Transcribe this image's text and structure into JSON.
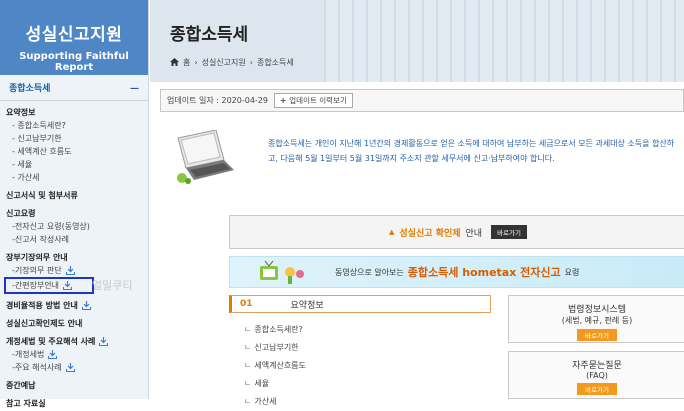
{
  "sidebar": {
    "brand_title": "성실신고지원",
    "brand_sub": "Supporting Faithful Report",
    "category": "종합소득세",
    "collapse": "—",
    "items": [
      {
        "label": "요약정보",
        "level": "h",
        "download": false
      },
      {
        "label": "- 종합소득세란?",
        "level": "s",
        "download": false
      },
      {
        "label": "- 신고납부기한",
        "level": "s",
        "download": false
      },
      {
        "label": "- 세액계산 흐름도",
        "level": "s",
        "download": false
      },
      {
        "label": "- 세율",
        "level": "s",
        "download": false
      },
      {
        "label": "- 가산세",
        "level": "s",
        "download": false
      },
      {
        "label": "신고서식 및 첨부서류",
        "level": "h",
        "download": false
      },
      {
        "label": "신고요령",
        "level": "h",
        "download": false
      },
      {
        "label": "-전자신고 요령(동영상)",
        "level": "s",
        "download": false
      },
      {
        "label": "-신고서 작성사례",
        "level": "s",
        "download": false
      },
      {
        "label": "장부기장의무 안내",
        "level": "h",
        "download": false
      },
      {
        "label": "-기장의무 판단",
        "level": "s",
        "download": true
      },
      {
        "label": "-간편장부안내",
        "level": "s",
        "download": true,
        "highlight": true
      },
      {
        "label": "경비율적용 방법 안내",
        "level": "h",
        "download": true
      },
      {
        "label": "성실신고확인제도 안내",
        "level": "h",
        "download": false
      },
      {
        "label": "개정세법 및 주요해석 사례",
        "level": "h",
        "download": true
      },
      {
        "label": "-개정세법",
        "level": "s",
        "download": true
      },
      {
        "label": "-주요 해석사례",
        "level": "s",
        "download": true
      },
      {
        "label": "중간예납",
        "level": "h",
        "download": false
      },
      {
        "label": "참고 자료실",
        "level": "h",
        "download": false
      }
    ]
  },
  "header": {
    "title": "종합소득세",
    "breadcrumb": [
      "홈",
      "성실신고지원",
      "종합소득세"
    ]
  },
  "update": {
    "label": "업데이트 일자 : 2020-04-29",
    "history_button": "업데이트 이력보기"
  },
  "intro": {
    "line1": "종합소득세는 개인이 지난해 1년간의 경제활동으로 얻은 소득에 대하여 납부하는 세금으로서 모든 과세대상 소득을 합산하",
    "line2": "고, 다음해 5월 1일부터 5월 31일까지 주소지 관할 세무서에 신고·납부하여야 합니다."
  },
  "promo1": {
    "text_orange": "성실신고 확인제",
    "text_rest": "안내",
    "button": "바로가기"
  },
  "promo2": {
    "prefix": "동영상으로 알아보는",
    "big": "종합소득세 hometax 전자신고",
    "suffix": "요령"
  },
  "panel": {
    "num": "01",
    "title": "요약정보",
    "items": [
      "종합소득세란?",
      "신고납부기한",
      "세액계산흐름도",
      "세율",
      "가산세"
    ]
  },
  "side_boxes": [
    {
      "title": "법령정보시스템",
      "sub": "(세법, 예규, 판례 등)",
      "button": "바로가기"
    },
    {
      "title": "자주묻는질문",
      "sub": "(FAQ)",
      "button": "바로가기"
    }
  ],
  "watermark": "얼밀쿠티"
}
